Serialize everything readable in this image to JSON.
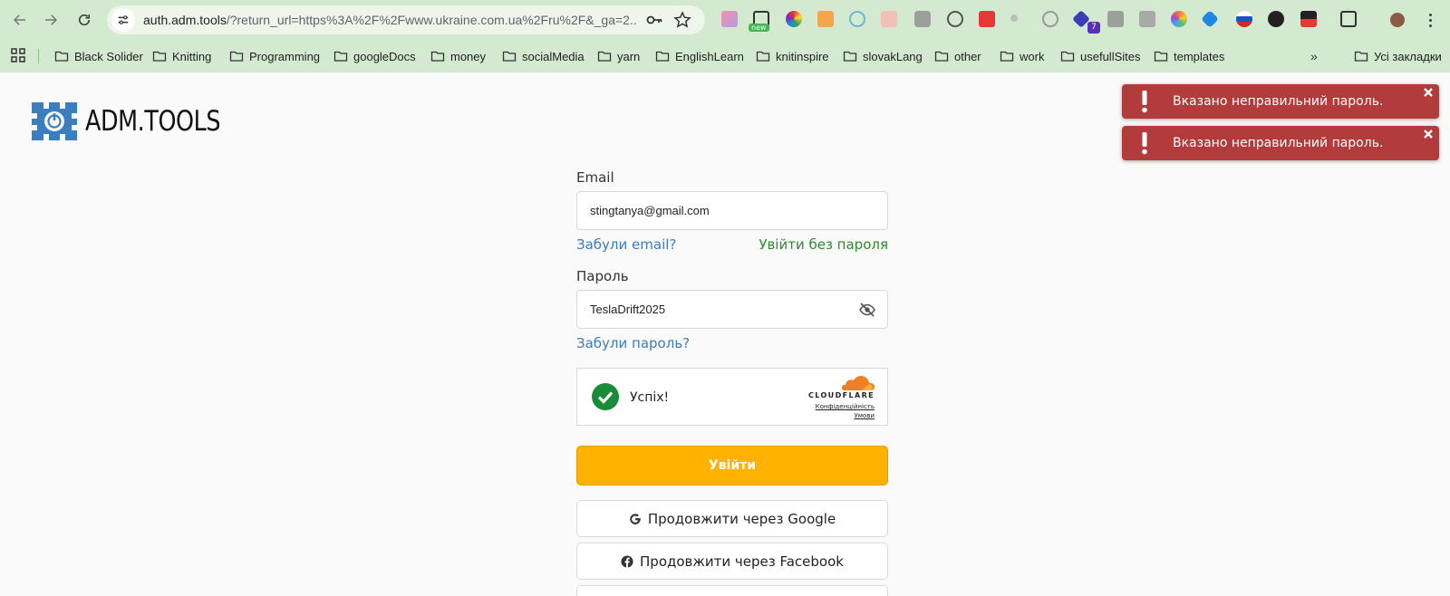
{
  "browser": {
    "url_host": "auth.adm.tools",
    "url_path": "/?return_url=https%3A%2F%2Fwww.ukraine.com.ua%2Fru%2F&_ga=2....",
    "extension_new_label": "new",
    "extension_badge_count": "7",
    "bookmarks": [
      "Black Solider",
      "Knitting",
      "Programming",
      "googleDocs",
      "money",
      "socialMedia",
      "yarn",
      "EnglishLearn",
      "knitinspire",
      "slovakLang",
      "other",
      "work",
      "usefullSites",
      "templates"
    ],
    "all_bookmarks_label": "Усі закладки"
  },
  "logo": {
    "text": "ADM.TOOLS",
    "color": "#3a7ebf"
  },
  "form": {
    "email_label": "Email",
    "email_value": "stingtanya@gmail.com",
    "forgot_email": "Забули email?",
    "login_without_password": "Увійти без пароля",
    "password_label": "Пароль",
    "password_value": "TeslaDrift2025",
    "forgot_password": "Забули пароль?",
    "submit_label": "Увійти",
    "google_label": "Продовжити через Google",
    "facebook_label": "Продовжити через Facebook"
  },
  "captcha": {
    "status": "Успіх!",
    "provider": "CLOUDFLARE",
    "privacy_link": "Конфіденційність",
    "terms_link": "Умови"
  },
  "toasts": [
    {
      "message": "Вказано неправильний пароль."
    },
    {
      "message": "Вказано неправильний пароль."
    }
  ],
  "colors": {
    "chrome_bg": "#d3ead0",
    "submit": "#ffb200",
    "toast": "#b23b3b",
    "link_blue": "#3d7bc0",
    "link_green": "#2f8a2c",
    "captcha_success": "#1a8b38"
  }
}
